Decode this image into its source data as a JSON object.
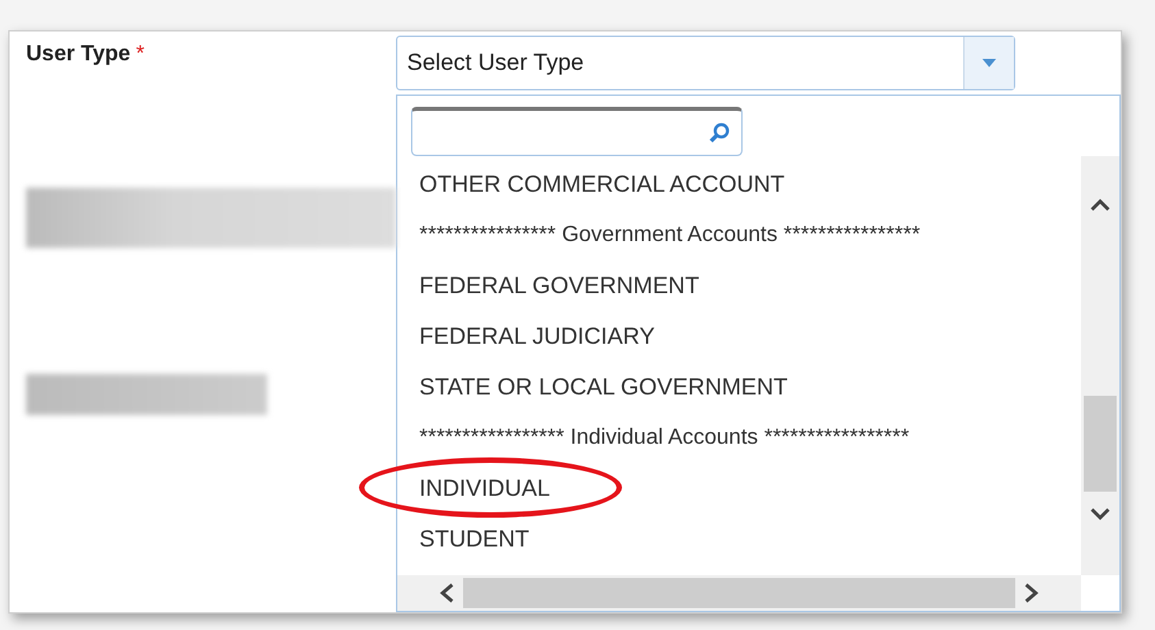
{
  "field": {
    "label": "User Type",
    "required_mark": "*",
    "placeholder": "Select User Type"
  },
  "dropdown": {
    "options": [
      {
        "kind": "option",
        "text": "OTHER COMMERCIAL ACCOUNT",
        "circled": false
      },
      {
        "kind": "header",
        "text": "**************** Government Accounts ****************",
        "circled": false
      },
      {
        "kind": "option",
        "text": "FEDERAL GOVERNMENT",
        "circled": false
      },
      {
        "kind": "option",
        "text": "FEDERAL JUDICIARY",
        "circled": false
      },
      {
        "kind": "option",
        "text": "STATE OR LOCAL GOVERNMENT",
        "circled": false
      },
      {
        "kind": "header",
        "text": "***************** Individual Accounts *****************",
        "circled": false
      },
      {
        "kind": "option",
        "text": "INDIVIDUAL",
        "circled": true
      },
      {
        "kind": "option",
        "text": "STUDENT",
        "circled": false
      }
    ]
  }
}
